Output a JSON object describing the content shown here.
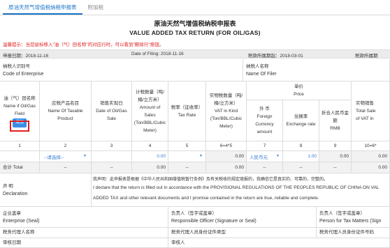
{
  "tabs": [
    {
      "label": "原油天然气增值税纳税申报表",
      "active": true
    },
    {
      "label": "附加税",
      "active": false
    }
  ],
  "title_cn": "原油天然气增值税纳税申报表",
  "title_en": "VALUE ADDED TAX RETURN (FOR OIL/GAS)",
  "hint": "温馨提示：当您鼠标移入\"油（气）田名称\"的对应行时，可以看到\"删除行\"按钮。",
  "infobar": {
    "declare_date": "申报日期：2018-11-16",
    "date_of_filing": "Date of Filing: 2018-11-16",
    "period": "税款所属期起：2018-03-01",
    "period_end": "税款所属期"
  },
  "enterprise": {
    "id_label_cn": "纳税人识别号",
    "id_label_en": "Code of Enterprise",
    "name_label_cn": "纳税人名称",
    "name_label_en": "Name Of Filer"
  },
  "columns": {
    "field_name": {
      "cn": "油（气）田名称",
      "en1": "Name if Oil/Gas",
      "en2": "Field",
      "button": "增加"
    },
    "taxable_product": {
      "cn": "应税产品名目",
      "en1": "Name Of Taxable",
      "en2": "Product"
    },
    "sale_date": {
      "cn": "销售实现日",
      "en1": "Date of Oil/Gas",
      "en2": "Sale"
    },
    "amount_of_sales": {
      "cn": "计税数量（吨/",
      "cn2": "桶/立方米）",
      "en1": "Amount of",
      "en2": "Sales",
      "en3": "(Ton/BBL/Cubic",
      "en4": "Meter)"
    },
    "tax_rate": {
      "cn": "税率（征收率）",
      "en1": "Tax Rate"
    },
    "vat_in_kind": {
      "cn": "实物税数量（吨/",
      "cn2": "桶/立方米）",
      "en1": "VAT in Kind",
      "en2": "(Ton/BBL/Cubic",
      "en3": "Meter)"
    },
    "price": {
      "cn": "单价",
      "en": "Price"
    },
    "foreign_currency": {
      "cn": "外 币",
      "en1": "Foreign",
      "en2": "Currency",
      "en3": "amount"
    },
    "exchange_rate": {
      "cn": "兑换率",
      "en1": "Exchange rate"
    },
    "rmb": {
      "cn": "折合人民币金额",
      "en1": "RMB"
    },
    "total_sale": {
      "cn": "实物销售",
      "en1": "Total Sale",
      "en2": "of VAT in"
    }
  },
  "col_numbers": [
    "1",
    "2",
    "3",
    "4",
    "5",
    "6=4*5",
    "7",
    "8",
    "9",
    "10=6*"
  ],
  "data_row": {
    "product_select": "--请选择--",
    "amount": "0.00",
    "vat_in_kind": "0.00",
    "currency": "人民币元",
    "exchange_rate": "1.00",
    "rmb": "0.00",
    "total": "0.00"
  },
  "total_row": {
    "label": "合计 Total",
    "c2": "--",
    "c3": "--",
    "c4": "0.00",
    "c5": "--",
    "c6": "0.00",
    "c7": "--",
    "c8": "--",
    "c9": "--",
    "c10": "0.00"
  },
  "declaration": {
    "label_cn": "声 明",
    "label_en": "Declaration",
    "text_cn": "我声明：此申报表是根据《中华人民共和国增值税暂行条例》及有关税收的规定填报的，我确信它是真实的、可靠的、完整的。",
    "text_en1": "I declare that the return is filled out in accordance with the PROVISIONAL REGULATIONS OF THE PEOPLES REPUBLIC OF CHINA ON VAL",
    "text_en2": "ADDED TAX and other relevant documents and I promise contained in the return are true, reliable and complete."
  },
  "signatures": {
    "enterprise_cn": "企业盖章",
    "enterprise_en": "Enterprise (Seal)",
    "officer_cn": "负责人（签字或盖章）",
    "officer_en": "Responsible Officer (Signature or Seal)",
    "tax_person_cn": "负责人（签字或盖章）",
    "tax_person_en": "Person for Tax Matters (Sign",
    "agent_name": "税务代理人名称",
    "agent_id_type": "税务代理人员身份证件类型",
    "agent_id_no": "税务代理人员身份证件号码",
    "review_date": "审核日期",
    "reviewer": "审核人"
  },
  "colors": {
    "accent": "#1a73c8",
    "warning": "#e02020",
    "button": "#3a8ee6"
  }
}
